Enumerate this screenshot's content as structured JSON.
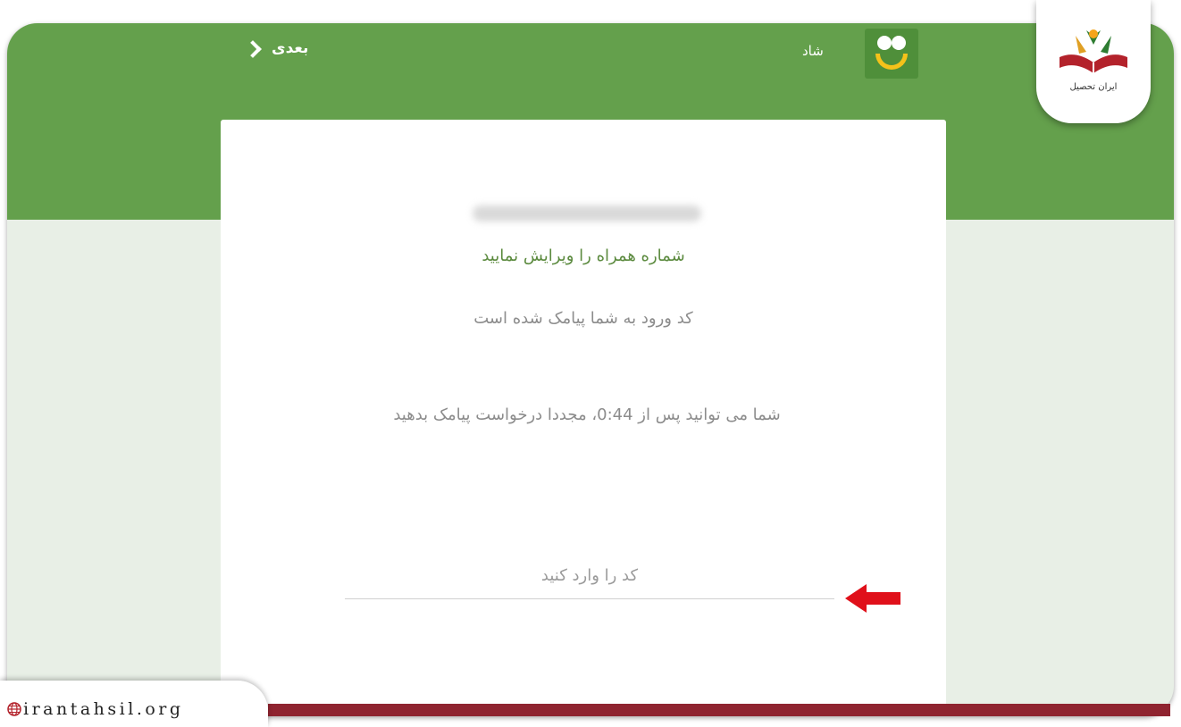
{
  "header": {
    "next_label": "بعدی",
    "app_name": "شاد"
  },
  "card": {
    "edit_phone_link": "شماره همراه را ویرایش نمایید",
    "sms_sent_text": "کد ورود به شما پیامک شده است",
    "resend_text": "شما می توانید پس از 0:44، مجددا درخواست پیامک بدهید",
    "code_input": {
      "placeholder": "کد را وارد کنید",
      "value": ""
    }
  },
  "watermark": {
    "brand_name": "ایران تحصیل",
    "url": "irantahsil.org"
  },
  "colors": {
    "header_green": "#64a04c",
    "link_green": "#5b8a3e",
    "arrow_red": "#e0101a",
    "bottom_bar": "#8f2430"
  },
  "icons": {
    "next": "chevron-left-icon",
    "app_logo": "shad-logo-icon",
    "pointer": "red-arrow-icon",
    "globe": "globe-icon"
  }
}
